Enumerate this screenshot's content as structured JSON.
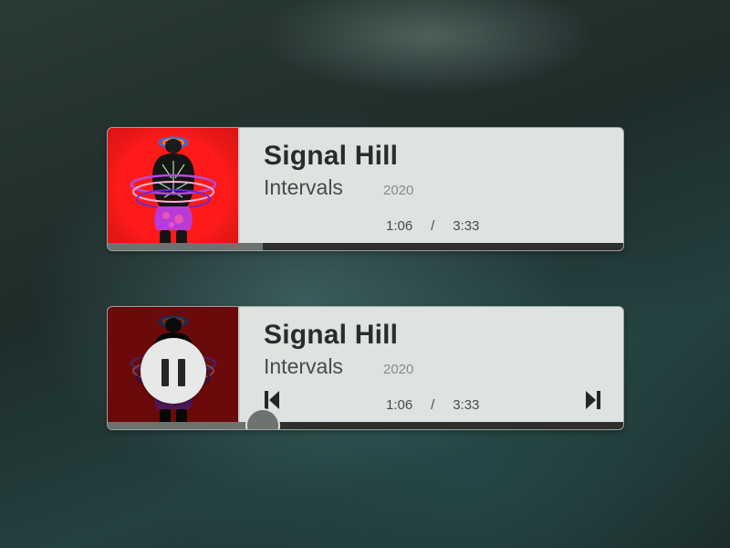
{
  "players": [
    {
      "title": "Signal Hill",
      "artist": "Intervals",
      "year": "2020",
      "current_time": "1:06",
      "separator": "/",
      "duration": "3:33",
      "progress": 0.3,
      "state": "idle"
    },
    {
      "title": "Signal Hill",
      "artist": "Intervals",
      "year": "2020",
      "current_time": "1:06",
      "separator": "/",
      "duration": "3:33",
      "progress": 0.3,
      "state": "hover",
      "controls": [
        "previous-icon",
        "pause-icon",
        "next-icon"
      ]
    }
  ],
  "colors": {
    "card_bg": "#dde3de",
    "art_bg": "#ff1a1a",
    "track": "#2e2e2e",
    "progress_fill": "#6e726f",
    "title_text": "#2b2b2b"
  }
}
